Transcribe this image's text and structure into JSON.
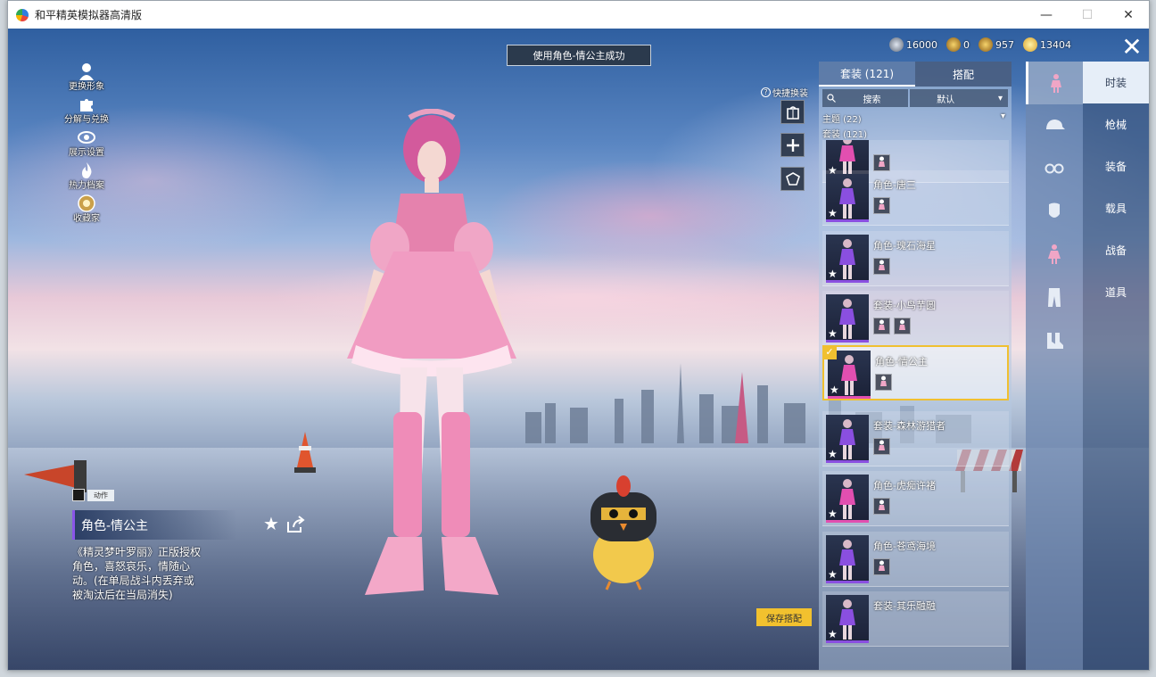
{
  "window": {
    "title": "和平精英模拟器高清版",
    "min_glyph": "—",
    "max_glyph": "☐",
    "close_glyph": "✕"
  },
  "toast": "使用角色-情公主成功",
  "currencies": [
    {
      "icon": "silver-coin-icon",
      "value": "16000",
      "color": "#9aa7b8"
    },
    {
      "icon": "gold-token-icon",
      "value": "0",
      "color": "#d9a12a"
    },
    {
      "icon": "gold-token-icon-2",
      "value": "957",
      "color": "#d9a12a"
    },
    {
      "icon": "bp-coin-icon",
      "value": "13404",
      "color": "#f1d04a"
    }
  ],
  "left_menu": [
    {
      "label": "更换形象",
      "icon": "person-icon"
    },
    {
      "label": "分解与兑换",
      "icon": "puzzle-icon"
    },
    {
      "label": "展示设置",
      "icon": "eye-icon"
    },
    {
      "label": "热力档案",
      "icon": "flame-icon"
    },
    {
      "label": "收藏家",
      "icon": "medal-icon"
    }
  ],
  "quick_change": "快捷换装",
  "action_tag": "动作",
  "selected_item": {
    "name": "角色-情公主",
    "description": "《精灵梦叶罗丽》正版授权角色，喜怒哀乐，情随心动。(在单局战斗内丢弃或被淘汰后在当局消失)"
  },
  "save_button": "保存搭配",
  "panel": {
    "tab_outfits": "套装 (121)",
    "tab_match": "搭配",
    "search_placeholder": "搜索",
    "sort_label": "默认",
    "theme_label": "主题 (22)",
    "count_label": "套装 (121)"
  },
  "items": [
    {
      "name": "",
      "minis": 1,
      "color": "#e24fb0",
      "selected": false
    },
    {
      "name": "角色-唐三",
      "minis": 1,
      "color": "#8a4fe0",
      "selected": false
    },
    {
      "name": "角色-瑰石海星",
      "minis": 1,
      "color": "#8a4fe0",
      "selected": false
    },
    {
      "name": "套装-小鸟芋圆",
      "minis": 2,
      "color": "#8a4fe0",
      "selected": false
    },
    {
      "name": "角色-情公主",
      "minis": 1,
      "color": "#e24fb0",
      "selected": true
    },
    {
      "name": "套装-森林游猎者",
      "minis": 1,
      "color": "#8a4fe0",
      "selected": false
    },
    {
      "name": "角色-虎痴许褚",
      "minis": 1,
      "color": "#e24fb0",
      "selected": false
    },
    {
      "name": "角色-苍鸢海境",
      "minis": 1,
      "color": "#8a4fe0",
      "selected": false
    },
    {
      "name": "套装-其乐融融",
      "minis": 0,
      "color": "#8a4fe0",
      "selected": false
    }
  ],
  "categories": [
    "body-icon",
    "cap-icon",
    "glasses-icon",
    "face-icon",
    "outfit-icon",
    "pants-icon",
    "shoes-icon"
  ],
  "side_nav": [
    {
      "label": "时装",
      "active": true
    },
    {
      "label": "枪械",
      "active": false
    },
    {
      "label": "装备",
      "active": false
    },
    {
      "label": "载具",
      "active": false
    },
    {
      "label": "战备",
      "active": false
    },
    {
      "label": "道具",
      "active": false
    }
  ],
  "close_glyph": "✕",
  "star_glyph": "★",
  "check_glyph": "✓",
  "chevron_glyph": "▾"
}
